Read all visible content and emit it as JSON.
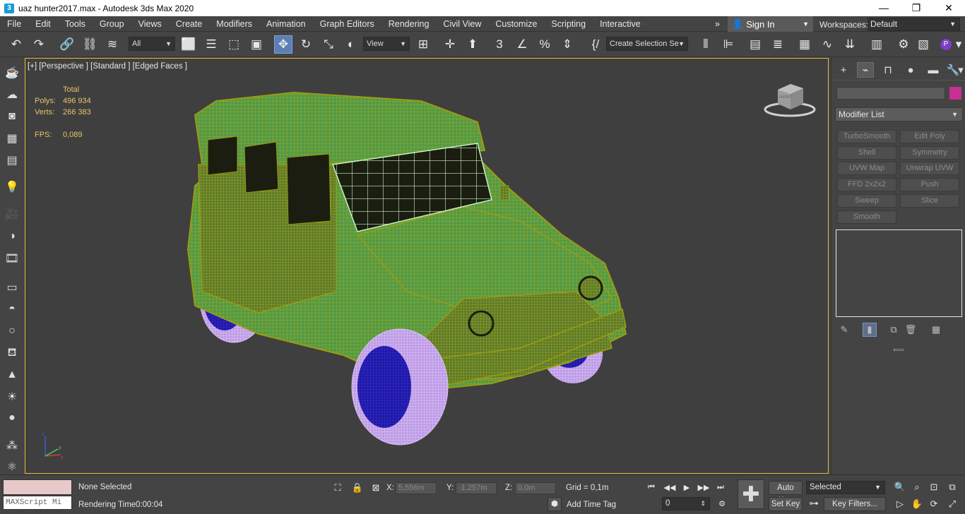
{
  "window": {
    "title": "uaz hunter2017.max - Autodesk 3ds Max 2020",
    "minimize": "—",
    "restore": "❐",
    "close": "✕"
  },
  "menu": [
    "File",
    "Edit",
    "Tools",
    "Group",
    "Views",
    "Create",
    "Modifiers",
    "Animation",
    "Graph Editors",
    "Rendering",
    "Civil View",
    "Customize",
    "Scripting",
    "Interactive"
  ],
  "menu_more": "»",
  "account": {
    "sign_in": "Sign In",
    "workspaces_label": "Workspaces:",
    "workspace": "Default"
  },
  "toolbar": {
    "filter": "All",
    "ref_coord": "View",
    "selection_set": "Create Selection Se"
  },
  "viewport": {
    "label": "[+] [Perspective ] [Standard ] [Edged Faces ]",
    "stats": {
      "header": "Total",
      "polys_label": "Polys:",
      "polys": "496 934",
      "verts_label": "Verts:",
      "verts": "266 383",
      "fps_label": "FPS:",
      "fps": "0,089"
    },
    "viewcube_text": "FRONT"
  },
  "command_panel": {
    "object_color": "#c62f94",
    "modifier_list": "Modifier List",
    "modifiers": [
      "TurboSmooth",
      "Edit Poly",
      "Shell",
      "Symmetry",
      "UVW Map",
      "Unwrap UVW",
      "FFD 2x2x2",
      "Push",
      "Sweep",
      "Slice",
      "Smooth"
    ]
  },
  "status": {
    "maxscript": "MAXScript Mi",
    "selection": "None Selected",
    "render_label": "Rendering Time",
    "render_time": "0:00:04",
    "x_label": "X:",
    "x": "5,556m",
    "y_label": "Y:",
    "y": "-1,257m",
    "z_label": "Z:",
    "z": "0,0m",
    "grid": "Grid = 0,1m",
    "add_time_tag": "Add Time Tag",
    "auto_key": "Auto Key",
    "set_key": "Set Key",
    "key_mode": "Selected",
    "frame": "0",
    "key_filters": "Key Filters..."
  }
}
